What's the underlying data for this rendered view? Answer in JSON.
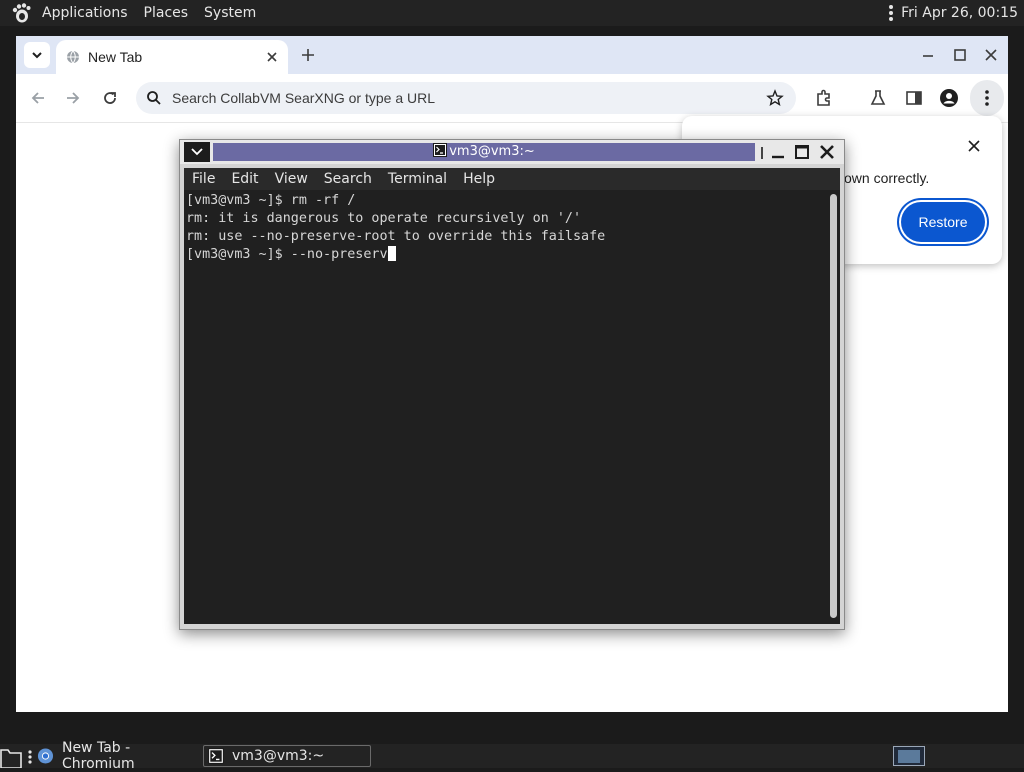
{
  "top_panel": {
    "menus": [
      "Applications",
      "Places",
      "System"
    ],
    "clock": "Fri Apr 26, 00:15"
  },
  "browser": {
    "tab_title": "New Tab",
    "omnibox_placeholder": "Search CollabVM SearXNG or type a URL",
    "restore_popup": {
      "message_visible": "own correctly.",
      "restore_label": "Restore"
    }
  },
  "terminal": {
    "title": "vm3@vm3:~",
    "menus": [
      "File",
      "Edit",
      "View",
      "Search",
      "Terminal",
      "Help"
    ],
    "lines": [
      "[vm3@vm3 ~]$ rm -rf /",
      "rm: it is dangerous to operate recursively on '/'",
      "rm: use --no-preserve-root to override this failsafe",
      "[vm3@vm3 ~]$ --no-preserv"
    ]
  },
  "taskbar": {
    "items": [
      "New Tab - Chromium",
      "vm3@vm3:~"
    ]
  },
  "colors": {
    "title_bar_active": "#6b6aa3",
    "restore_button": "#0b57d0",
    "browser_tabstrip": "#dfe6f5"
  }
}
